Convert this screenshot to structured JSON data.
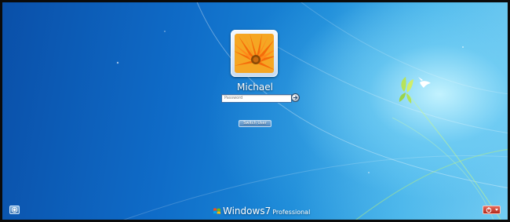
{
  "login": {
    "username": "Michael",
    "password_placeholder": "Password",
    "switch_user_label": "Switch User"
  },
  "branding": {
    "product": "Windows",
    "version": "7",
    "edition": "Professional"
  },
  "icons": {
    "ease_of_access": "ease-of-access-icon",
    "shutdown": "shutdown-icon",
    "submit": "arrow-right-icon",
    "logo": "windows-flag-icon"
  },
  "colors": {
    "background_dark": "#0a4fa8",
    "background_light": "#7fd2f2",
    "shutdown_red": "#c0392b",
    "account_picture_orange": "#f07a0c"
  }
}
